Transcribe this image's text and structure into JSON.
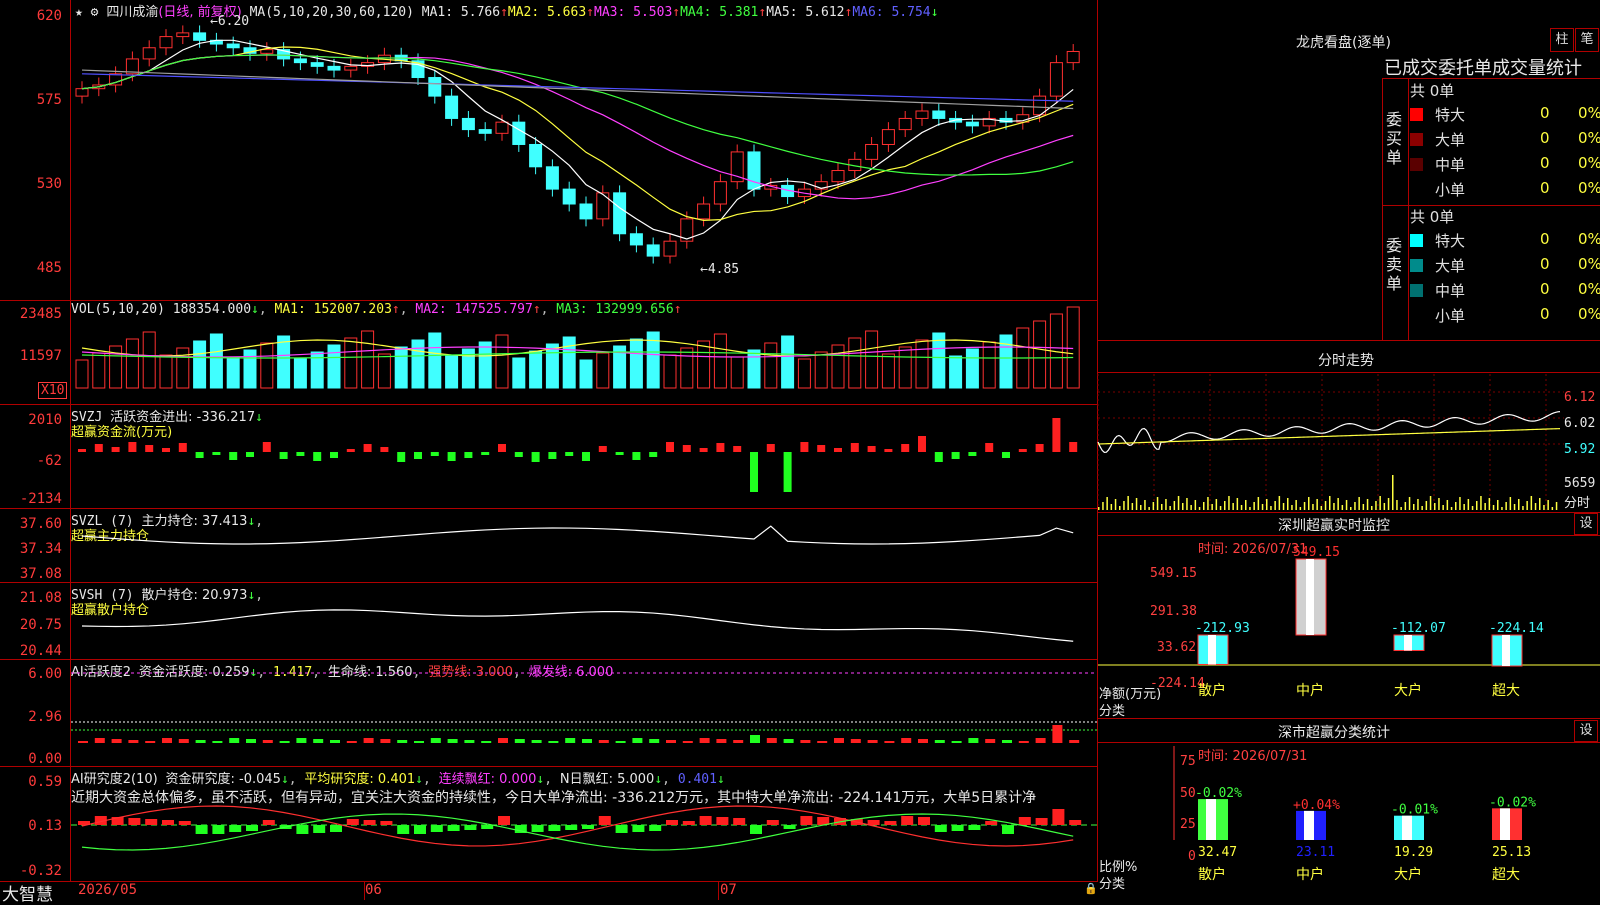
{
  "header": {
    "stock_name": "四川成渝",
    "period": "(日线, 前复权)",
    "ma_label": "MA(5,10,20,30,60,120)",
    "ma1": "MA1: 5.766",
    "ma2": "MA2: 5.663",
    "ma3": "MA3: 5.503",
    "ma4": "MA4: 5.381",
    "ma5": "MA5: 5.612",
    "ma6": "MA6: 5.754",
    "high_mark": "6.20",
    "low_mark": "4.85"
  },
  "price_axis": [
    "620",
    "575",
    "530",
    "485"
  ],
  "vol": {
    "label": "VOL(5,10,20)",
    "value": "188354.000",
    "ma1": "MA1: 152007.203",
    "ma2": "MA2: 147525.797",
    "ma3": "MA3: 132999.656",
    "axis": [
      "23485",
      "11597"
    ],
    "unit": "X10"
  },
  "svzj": {
    "label": "SVZJ",
    "title": "活跃资金进出: -336.217",
    "subtitle": "超赢资金流(万元)",
    "axis": [
      "2010",
      "-62",
      "-2134"
    ]
  },
  "svzl": {
    "label": "SVZL (7)",
    "title": "主力持仓: 37.413",
    "subtitle": "超赢主力持仓",
    "axis": [
      "37.60",
      "37.34",
      "37.08"
    ]
  },
  "svsh": {
    "label": "SVSH (7)",
    "title": "散户持仓: 20.973",
    "subtitle": "超赢散户持仓",
    "axis": [
      "21.08",
      "20.75",
      "20.44"
    ]
  },
  "ai_active": {
    "label": "AI活跃度2",
    "text1": "资金活跃度: 0.259",
    "text2": "1.417",
    "text3": "生命线: 1.560",
    "text4": "强势线: 3.000",
    "text5": "爆发线: 6.000",
    "axis": [
      "6.00",
      "2.96",
      "0.00"
    ]
  },
  "ai_research": {
    "label": "AI研究度2(10)",
    "text1": "资金研究度: -0.045",
    "text2": "平均研究度: 0.401",
    "text3": "连续飘红: 0.000",
    "text4": "N日飘红: 5.000",
    "text5": "0.401",
    "comment": "近期大资金总体偏多，虽不活跃，但有异动，宜关注大资金的持续性，今日大单净流出: -336.212万元，其中特大单净流出: -224.141万元，大单5日累计净",
    "axis": [
      "0.59",
      "0.13",
      "-0.32"
    ]
  },
  "bottom_bar": {
    "brand": "大智慧",
    "dates": [
      "2026/05",
      "06",
      "07"
    ]
  },
  "right": {
    "dragon_title": "龙虎看盘(逐单)",
    "btn_zhu": "柱",
    "btn_bi": "笔",
    "tabs_text": "已成交委托单成交量统计",
    "buy_side_label": "委买单",
    "sell_side_label": "委卖单",
    "buy_total": "共 0单",
    "sell_total": "共 0单",
    "buy_rows": [
      {
        "name": "特大",
        "count": "0",
        "pct": "0%",
        "color": "#ff0000"
      },
      {
        "name": "大单",
        "count": "0",
        "pct": "0%",
        "color": "#8b0000"
      },
      {
        "name": "中单",
        "count": "0",
        "pct": "0%",
        "color": "#5a0000"
      },
      {
        "name": "小单",
        "count": "0",
        "pct": "0%",
        "color": "#000000"
      }
    ],
    "sell_rows": [
      {
        "name": "特大",
        "count": "0",
        "pct": "0%",
        "color": "#00ffff"
      },
      {
        "name": "大单",
        "count": "0",
        "pct": "0%",
        "color": "#008b8b"
      },
      {
        "name": "中单",
        "count": "0",
        "pct": "0%",
        "color": "#007070"
      },
      {
        "name": "小单",
        "count": "0",
        "pct": "0%",
        "color": "#000000"
      }
    ],
    "intraday_title": "分时走势",
    "intraday_axis": [
      "6.12",
      "6.02",
      "5.92"
    ],
    "intraday_vol": "5659",
    "intraday_vol_unit": "分时",
    "sz_monitor_title": "深圳超赢实时监控",
    "sz_monitor_btn": "设",
    "sz_monitor_time": "时间: 2026/07/31",
    "sz_monitor_axis": [
      "549.15",
      "291.38",
      "33.62",
      "-224.14"
    ],
    "sz_monitor_axis_label": "净额(万元)",
    "sz_monitor_axis_label2": "分类",
    "sz_monitor_values": [
      "-212.93",
      "549.15",
      "-112.07",
      "-224.14"
    ],
    "sz_categories": [
      "散户",
      "中户",
      "大户",
      "超大"
    ],
    "sz_stat_title": "深市超赢分类统计",
    "sz_stat_btn": "设",
    "sz_stat_time": "时间: 2026/07/31",
    "sz_stat_axis": [
      "75",
      "50",
      "25",
      "0"
    ],
    "sz_stat_axis_label": "比例%",
    "sz_stat_axis_label2": "分类",
    "sz_stat_changes": [
      "-0.02%",
      "+0.04%",
      "-0.01%",
      "-0.02%"
    ],
    "sz_stat_values": [
      "32.47",
      "23.11",
      "19.29",
      "25.13"
    ]
  }
}
